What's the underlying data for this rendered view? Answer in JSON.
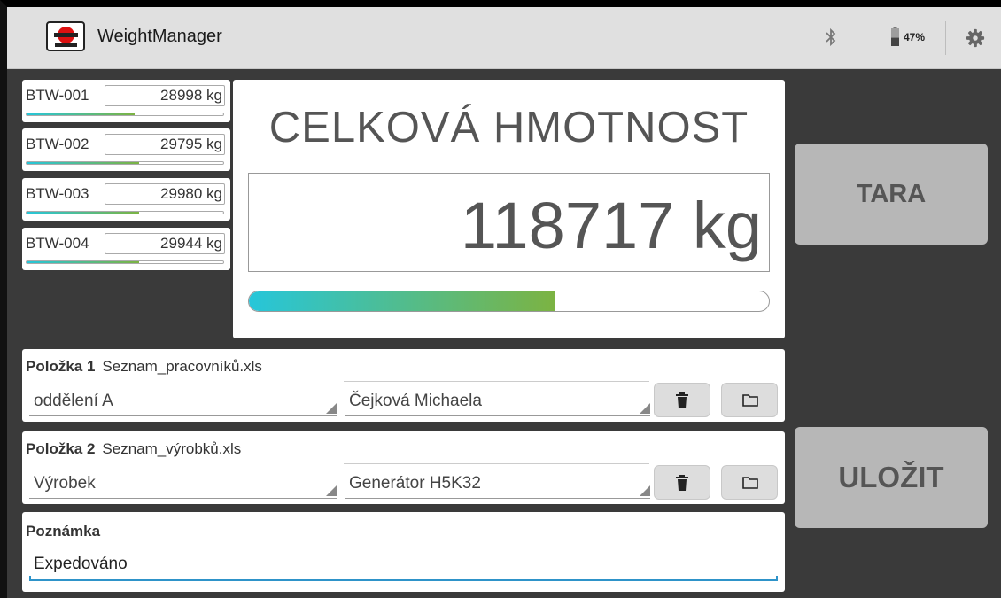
{
  "app": {
    "title": "WeightManager"
  },
  "status": {
    "battery_percent": "47%",
    "battery_level": 0.47
  },
  "colors": {
    "accent_blue": "#2e93c9",
    "gradient_start": "#26c6da",
    "gradient_end": "#7cb342",
    "button_bg": "#b7b7b7",
    "background": "#3a3a3a"
  },
  "sensors": [
    {
      "name": "BTW-001",
      "value": "28998 kg",
      "level": 0.55
    },
    {
      "name": "BTW-002",
      "value": "29795 kg",
      "level": 0.57
    },
    {
      "name": "BTW-003",
      "value": "29980 kg",
      "level": 0.57
    },
    {
      "name": "BTW-004",
      "value": "29944 kg",
      "level": 0.57
    }
  ],
  "total": {
    "title": "CELKOVÁ HMOTNOST",
    "value": "118717 kg",
    "level": 0.59
  },
  "buttons": {
    "tara": "TARA",
    "save": "ULOŽIT"
  },
  "items": [
    {
      "label": "Položka 1",
      "file": "Seznam_pracovníků.xls",
      "dropdown1": "oddělení A",
      "dropdown2": "Čejková Michaela"
    },
    {
      "label": "Položka 2",
      "file": "Seznam_výrobků.xls",
      "dropdown1": "Výrobek",
      "dropdown2": "Generátor H5K32"
    }
  ],
  "note": {
    "label": "Poznámka",
    "value": "Expedováno"
  },
  "icons": {
    "logo": "logo-icon",
    "bluetooth": "bluetooth-icon",
    "battery": "battery-icon",
    "settings": "gear-icon",
    "delete": "trash-icon",
    "open": "folder-icon"
  }
}
